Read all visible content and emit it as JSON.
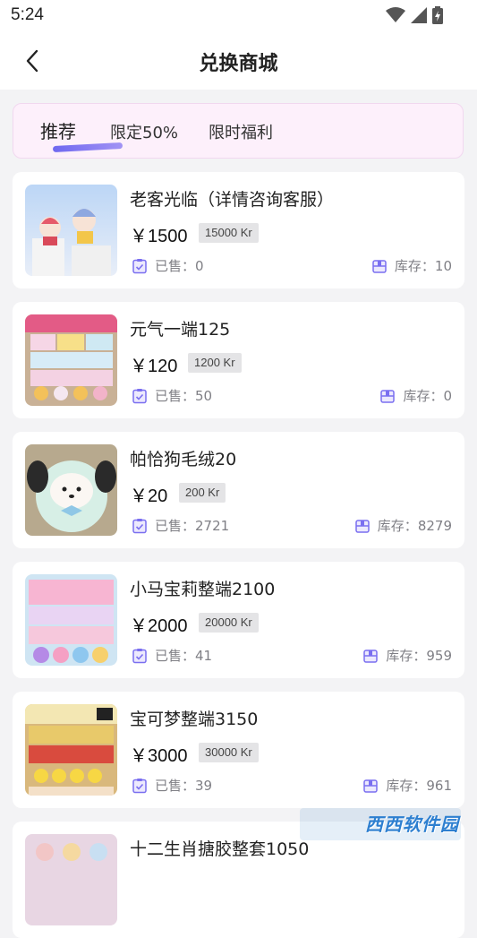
{
  "status_bar": {
    "time": "5:24",
    "icons": [
      "wifi-icon",
      "cell-signal-icon",
      "battery-icon"
    ]
  },
  "header": {
    "title": "兑换商城",
    "back_icon": "chevron-left-icon"
  },
  "tabs": [
    {
      "label": "推荐",
      "active": true
    },
    {
      "label": "限定50%",
      "active": false
    },
    {
      "label": "限时福利",
      "active": false
    }
  ],
  "products": [
    {
      "name": "老客光临（详情咨询客服）",
      "price": "￥1500",
      "kr": "15000 Kr",
      "sold_label": "已售：",
      "sold": "0",
      "stock_label": "库存：",
      "stock": "10"
    },
    {
      "name": "元气一端125",
      "price": "￥120",
      "kr": "1200 Kr",
      "sold_label": "已售：",
      "sold": "50",
      "stock_label": "库存：",
      "stock": "0"
    },
    {
      "name": "帕恰狗毛绒20",
      "price": "￥20",
      "kr": "200 Kr",
      "sold_label": "已售：",
      "sold": "2721",
      "stock_label": "库存：",
      "stock": "8279"
    },
    {
      "name": "小马宝莉整端2100",
      "price": "￥2000",
      "kr": "20000 Kr",
      "sold_label": "已售：",
      "sold": "41",
      "stock_label": "库存：",
      "stock": "959"
    },
    {
      "name": "宝可梦整端3150",
      "price": "￥3000",
      "kr": "30000 Kr",
      "sold_label": "已售：",
      "sold": "39",
      "stock_label": "库存：",
      "stock": "961"
    },
    {
      "name": "十二生肖搪胶整套1050",
      "price": "",
      "kr": "",
      "sold_label": "",
      "sold": "",
      "stock_label": "",
      "stock": ""
    }
  ],
  "watermark": "西西软件园",
  "colors": {
    "accent": "#7a6ff0",
    "tabs_bg": "#fdf0fb",
    "card_bg": "#ffffff",
    "page_bg": "#f3f3f5",
    "muted_text": "#7f7f85"
  }
}
